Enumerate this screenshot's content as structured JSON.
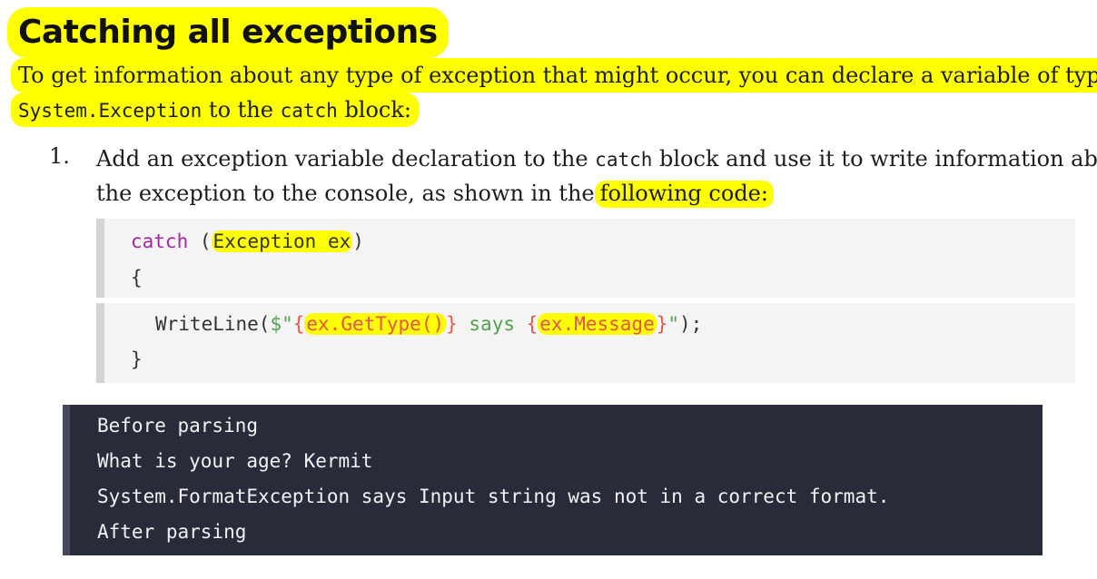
{
  "heading": "Catching all exceptions",
  "intro": {
    "line1": "To get information about any type of exception that might occur, you can declare a variable of type",
    "line2_code1": "System.Exception",
    "line2_text1": " to the ",
    "line2_code2": "catch",
    "line2_text2": " block:"
  },
  "step": {
    "number": "1.",
    "line1_a": "Add an exception variable declaration to the ",
    "line1_code": "catch",
    "line1_b": " block and use it to write information about",
    "line2_a": "the exception to the console, as shown in the",
    "line2_hl": "following code:"
  },
  "code": {
    "l1_kw": "catch",
    "l1_sp": " (",
    "l1_hl": "Exception ex",
    "l1_end": ")",
    "l2": "{",
    "l3_a": "WriteLine(",
    "l3_str1": "$\"",
    "l3_b1": "{",
    "l3_hl1": "ex.GetType()",
    "l3_b2": "}",
    "l3_str2": " says ",
    "l3_b3": "{",
    "l3_hl2": "ex.Message",
    "l3_b4": "}",
    "l3_str3": "\"",
    "l3_end": ");",
    "l4": "}"
  },
  "console": {
    "lines": [
      "Before parsing",
      "What is your age? Kermit",
      "System.FormatException says Input string was not in a correct format.",
      "After parsing"
    ]
  },
  "colors": {
    "highlight": "#ffff00",
    "keyword": "#a626a4",
    "string": "#50a14f",
    "interpolation": "#e45649",
    "console_bg": "#282c3a"
  }
}
